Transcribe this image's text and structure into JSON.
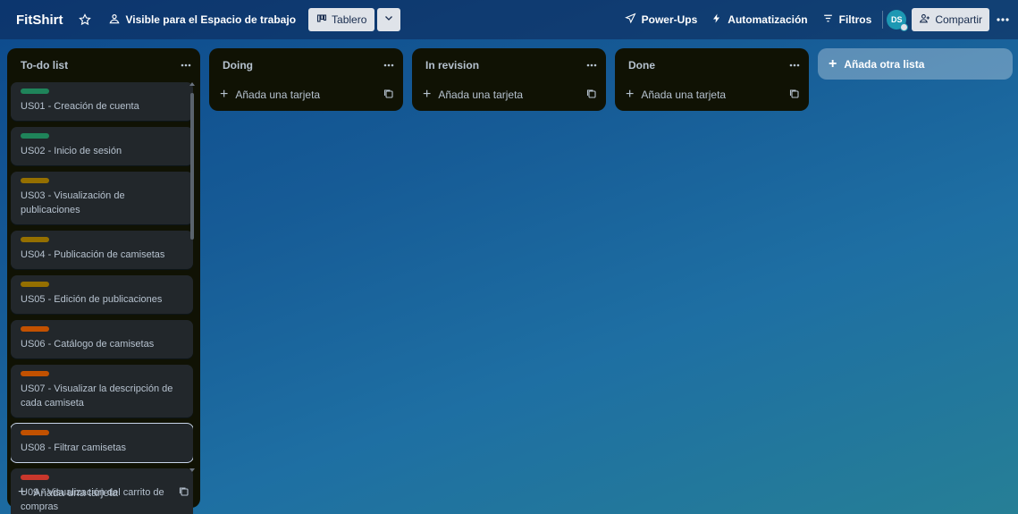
{
  "header": {
    "board_name": "FitShirt",
    "visibility": "Visible para el Espacio de trabajo",
    "view_label": "Tablero",
    "powerups": "Power-Ups",
    "automation": "Automatización",
    "filters": "Filtros",
    "avatar_initials": "DS",
    "share": "Compartir"
  },
  "colors": {
    "label_green": "#1f845a",
    "label_yellow": "#946f00",
    "label_orange": "#c25100",
    "label_red": "#c9372c"
  },
  "lists": [
    {
      "title": "To-do list",
      "add_card": "Añada una tarjeta",
      "cards": [
        {
          "title": "US01 - Creación de cuenta",
          "label_color": "#1f845a"
        },
        {
          "title": "US02 - Inicio de sesión",
          "label_color": "#1f845a"
        },
        {
          "title": "US03 - Visualización de publicaciones",
          "label_color": "#946f00"
        },
        {
          "title": "US04 - Publicación de camisetas",
          "label_color": "#946f00"
        },
        {
          "title": "US05 - Edición de publicaciones",
          "label_color": "#946f00"
        },
        {
          "title": "US06 - Catálogo de camisetas",
          "label_color": "#c25100"
        },
        {
          "title": "US07 - Visualizar la descripción de cada camiseta",
          "label_color": "#c25100"
        },
        {
          "title": "US08 - Filtrar camisetas",
          "label_color": "#c25100"
        },
        {
          "title": "U09 - Visualización del carrito de compras",
          "label_color": "#c9372c"
        }
      ]
    },
    {
      "title": "Doing",
      "add_card": "Añada una tarjeta",
      "cards": []
    },
    {
      "title": "In revision",
      "add_card": "Añada una tarjeta",
      "cards": []
    },
    {
      "title": "Done",
      "add_card": "Añada una tarjeta",
      "cards": []
    }
  ],
  "add_list": "Añada otra lista"
}
